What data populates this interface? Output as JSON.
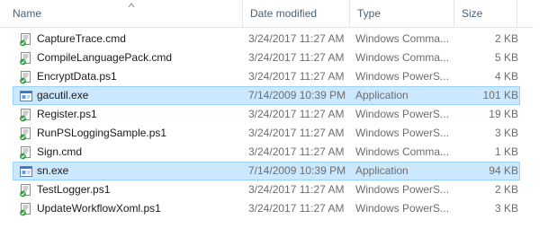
{
  "columns": {
    "name": "Name",
    "date": "Date modified",
    "type": "Type",
    "size": "Size"
  },
  "files": [
    {
      "name": "CaptureTrace.cmd",
      "date": "3/24/2017 11:27 AM",
      "type": "Windows Comma...",
      "size": "2 KB",
      "icon": "script-file-icon",
      "selected": false
    },
    {
      "name": "CompileLanguagePack.cmd",
      "date": "3/24/2017 11:27 AM",
      "type": "Windows Comma...",
      "size": "5 KB",
      "icon": "script-file-icon",
      "selected": false
    },
    {
      "name": "EncryptData.ps1",
      "date": "3/24/2017 11:27 AM",
      "type": "Windows PowerS...",
      "size": "4 KB",
      "icon": "script-file-icon",
      "selected": false
    },
    {
      "name": "gacutil.exe",
      "date": "7/14/2009 10:39 PM",
      "type": "Application",
      "size": "101 KB",
      "icon": "application-icon",
      "selected": true
    },
    {
      "name": "Register.ps1",
      "date": "3/24/2017 11:27 AM",
      "type": "Windows PowerS...",
      "size": "19 KB",
      "icon": "script-file-icon",
      "selected": false
    },
    {
      "name": "RunPSLoggingSample.ps1",
      "date": "3/24/2017 11:27 AM",
      "type": "Windows PowerS...",
      "size": "3 KB",
      "icon": "script-file-icon",
      "selected": false
    },
    {
      "name": "Sign.cmd",
      "date": "3/24/2017 11:27 AM",
      "type": "Windows Comma...",
      "size": "1 KB",
      "icon": "script-file-icon",
      "selected": false
    },
    {
      "name": "sn.exe",
      "date": "7/14/2009 10:39 PM",
      "type": "Application",
      "size": "94 KB",
      "icon": "application-icon",
      "selected": true
    },
    {
      "name": "TestLogger.ps1",
      "date": "3/24/2017 11:27 AM",
      "type": "Windows PowerS...",
      "size": "2 KB",
      "icon": "script-file-icon",
      "selected": false
    },
    {
      "name": "UpdateWorkflowXoml.ps1",
      "date": "3/24/2017 11:27 AM",
      "type": "Windows PowerS...",
      "size": "3 KB",
      "icon": "script-file-icon",
      "selected": false
    }
  ],
  "colors": {
    "selection": "#cce8ff",
    "selection_border": "#99d1ff",
    "header_text": "#4c607a",
    "muted_text": "#6d6d6d"
  }
}
